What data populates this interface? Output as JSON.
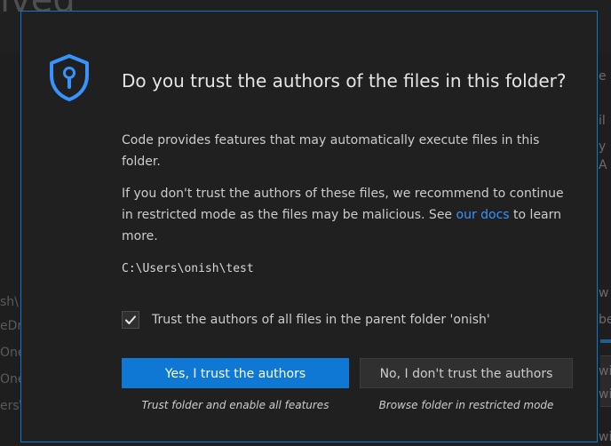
{
  "background": {
    "heading_fragment": "lved",
    "left_fragments": [
      "sh\\",
      "eDr",
      "One",
      "One",
      "ers\\"
    ],
    "right_fragments": [
      "e",
      "il",
      "y",
      "A",
      "w",
      "be",
      "wi",
      "wi",
      "wi"
    ]
  },
  "dialog": {
    "icon": "shield-lock-icon",
    "title": "Do you trust the authors of the files in this folder?",
    "paragraph1": "Code provides features that may automatically execute files in this folder.",
    "paragraph2_prefix": "If you don't trust the authors of these files, we recommend to continue in restricted mode as the files may be malicious. See ",
    "paragraph2_link": "our docs",
    "paragraph2_suffix": " to learn more.",
    "folder_path": "C:\\Users\\onish\\test",
    "parent_checkbox": {
      "checked": true,
      "label": "Trust the authors of all files in the parent folder 'onish'"
    },
    "buttons": {
      "trust": {
        "label": "Yes, I trust the authors",
        "caption": "Trust folder and enable all features"
      },
      "distrust": {
        "label": "No, I don't trust the authors",
        "caption": "Browse folder in restricted mode"
      }
    }
  },
  "colors": {
    "accent": "#0e78d4",
    "link": "#3794ff",
    "dialog_background": "#202020",
    "border": "#0e76d4"
  }
}
